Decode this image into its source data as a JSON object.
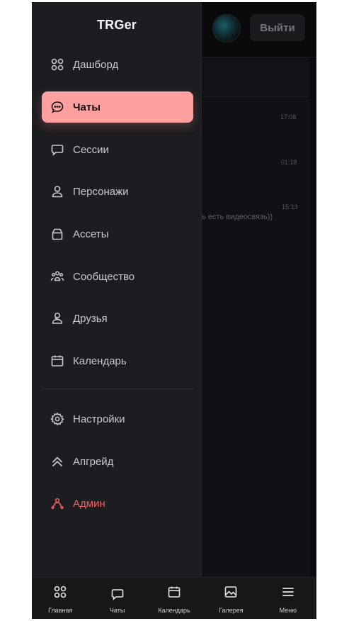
{
  "brand": "TRGer",
  "background": {
    "logout_label": "Выйти",
    "times": [
      "17:08",
      "01:18",
      "15:13"
    ],
    "snippet": "ь есть видеосвязь))"
  },
  "drawer": {
    "items": [
      {
        "label": "Дашборд",
        "icon": "grid-icon"
      },
      {
        "label": "Чаты",
        "icon": "chat-bubble-icon",
        "active": true
      },
      {
        "label": "Сессии",
        "icon": "message-square-icon"
      },
      {
        "label": "Персонажи",
        "icon": "user-icon"
      },
      {
        "label": "Ассеты",
        "icon": "package-icon"
      },
      {
        "label": "Сообщество",
        "icon": "users-icon"
      },
      {
        "label": "Друзья",
        "icon": "friends-icon"
      },
      {
        "label": "Календарь",
        "icon": "calendar-icon"
      }
    ],
    "bottom_items": [
      {
        "label": "Настройки",
        "icon": "gear-icon"
      },
      {
        "label": "Апгрейд",
        "icon": "chevrons-up-icon"
      },
      {
        "label": "Админ",
        "icon": "admin-icon"
      }
    ]
  },
  "bottom_nav": [
    {
      "label": "Главная",
      "icon": "grid-icon"
    },
    {
      "label": "Чаты",
      "icon": "message-square-icon"
    },
    {
      "label": "Календарь",
      "icon": "calendar-icon"
    },
    {
      "label": "Галерея",
      "icon": "image-icon"
    },
    {
      "label": "Меню",
      "icon": "menu-icon"
    }
  ],
  "colors": {
    "accent": "#ffa0a0",
    "admin": "#ff5a5a",
    "drawer_bg": "#1c1d20"
  }
}
